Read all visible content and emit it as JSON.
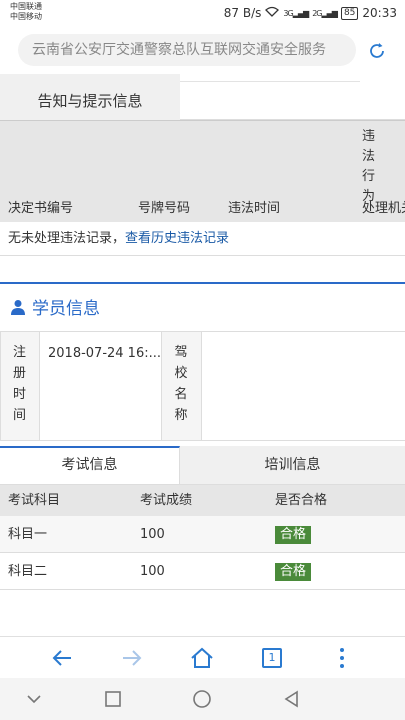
{
  "status_bar": {
    "carrier_1": "中国联通",
    "carrier_2": "中国移动",
    "speed": "87 B/s",
    "signal_1": "3G",
    "signal_2": "2G",
    "battery": "85",
    "time": "20:33"
  },
  "address_bar": {
    "url_text": "云南省公安厅交通警察总队互联网交通安全服务",
    "refresh_icon": "refresh-icon"
  },
  "notice": {
    "tab_label": "告知与提示信息",
    "columns": [
      "决定书编号",
      "号牌号码",
      "违法时间"
    ],
    "vertical_column_label": "违法行为",
    "last_column_label": "处理机关",
    "empty_text": "无未处理违法记录，",
    "history_link": "查看历史违法记录"
  },
  "student": {
    "title": "学员信息",
    "register_time_label": "注册时间",
    "register_time_value": "2018-07-24 16:...",
    "driving_school_label": "驾校名称",
    "driving_school_value": ""
  },
  "tabs": {
    "exam": "考试信息",
    "training": "培训信息"
  },
  "exam": {
    "headers": [
      "考试科目",
      "考试成绩",
      "是否合格"
    ],
    "rows": [
      {
        "subject": "科目一",
        "score": "100",
        "result": "合格"
      },
      {
        "subject": "科目二",
        "score": "100",
        "result": "合格"
      }
    ],
    "pass_color": "#4a8a3a"
  },
  "toolbar": {
    "tab_count": "1"
  },
  "colors": {
    "accent": "#2a6ac8"
  }
}
